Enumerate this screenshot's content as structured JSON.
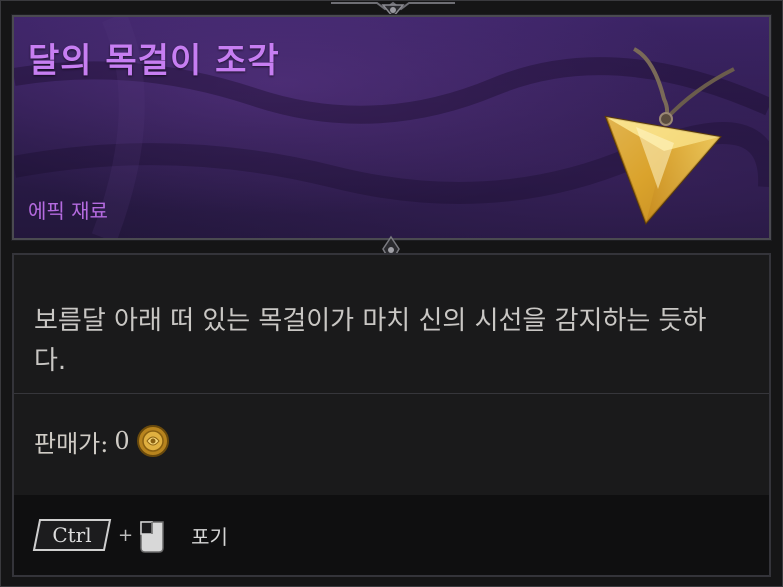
{
  "item": {
    "title": "달의 목걸이 조각",
    "rarity": "에픽 재료",
    "description": "보름달 아래 떠 있는 목걸이가 마치 신의 시선을 감지하는 듯하다."
  },
  "price": {
    "label": "판매가:",
    "value": "0",
    "icon": "coin-icon"
  },
  "controls": {
    "modifier_key": "Ctrl",
    "plus": "+",
    "mouse_icon": "mouse-click-icon",
    "action_label": "포기"
  },
  "colors": {
    "title": "#c77ef2",
    "rarity": "#b56be0",
    "header_bg": "#2b1b4a",
    "gem": "#e8b83a"
  }
}
